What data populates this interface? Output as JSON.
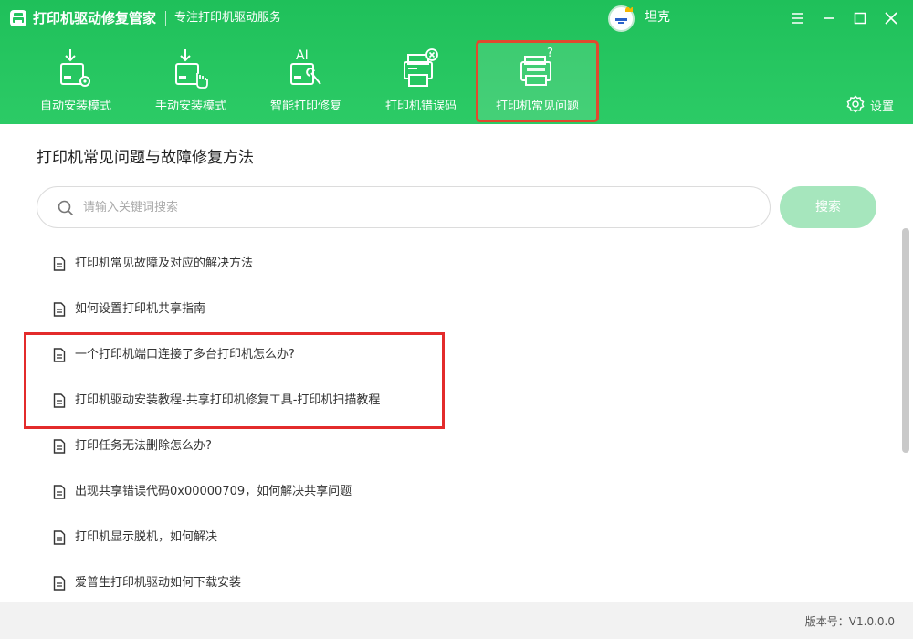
{
  "app": {
    "title": "打印机驱动修复管家",
    "subtitle": "专注打印机驱动服务",
    "username": "坦克"
  },
  "nav": {
    "tabs": [
      {
        "label": "自动安装模式",
        "icon": "auto-install-icon"
      },
      {
        "label": "手动安装模式",
        "icon": "manual-install-icon"
      },
      {
        "label": "智能打印修复",
        "icon": "ai-repair-icon"
      },
      {
        "label": "打印机错误码",
        "icon": "printer-error-icon"
      },
      {
        "label": "打印机常见问题",
        "icon": "printer-faq-icon",
        "active": true
      }
    ],
    "settings_label": "设置"
  },
  "main": {
    "title": "打印机常见问题与故障修复方法",
    "search": {
      "placeholder": "请输入关键词搜索",
      "value": "",
      "button_label": "搜索"
    },
    "items": [
      "打印机常见故障及对应的解决方法",
      "如何设置打印机共享指南",
      "一个打印机端口连接了多台打印机怎么办?",
      "打印机驱动安装教程-共享打印机修复工具-打印机扫描教程",
      "打印任务无法删除怎么办?",
      "出现共享错误代码0x00000709，如何解决共享问题",
      "打印机显示脱机，如何解决",
      "爱普生打印机驱动如何下载安装"
    ]
  },
  "footer": {
    "version": "版本号：V1.0.0.0"
  },
  "colors": {
    "header_green": "#22c45e",
    "search_button": "#a6e6bd",
    "active_tab_border": "#e0492e",
    "highlight_border": "#e32b2b"
  }
}
